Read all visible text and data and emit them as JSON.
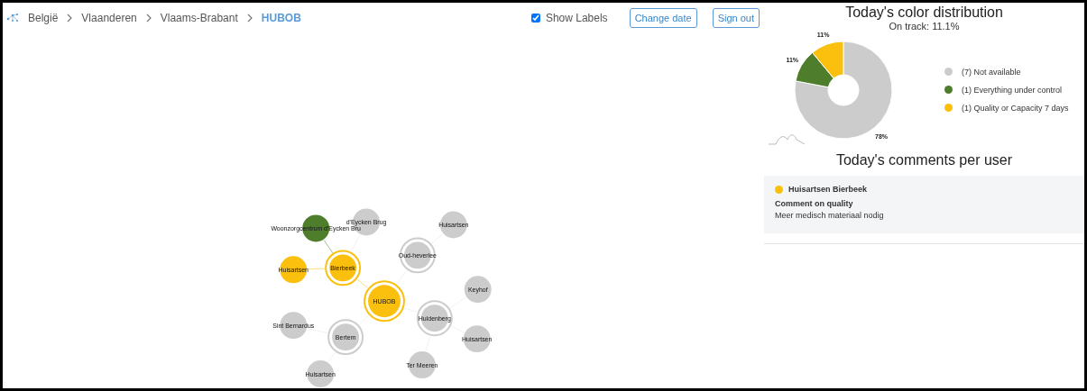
{
  "breadcrumb": {
    "items": [
      "België",
      "Vlaanderen",
      "Vlaams-Brabant"
    ],
    "current": "HUBOB"
  },
  "show_labels": {
    "label": "Show Labels",
    "checked": true
  },
  "buttons": [
    "Change date",
    "Sign out"
  ],
  "graph": {
    "root": {
      "label": "HUBOB",
      "color": "#fbbf0e",
      "children": [
        {
          "label": "Bierbeek",
          "color": "#fbbf0e",
          "children": [
            {
              "label": "Woonzorgcentrum d'Eycken Bru",
              "color": "#4e7e2c"
            },
            {
              "label": "d'Eycken Brug",
              "color": "#cccccc"
            },
            {
              "label": "Huisartsen",
              "color": "#fbbf0e"
            }
          ]
        },
        {
          "label": "Oud-heverlee",
          "color": "#cccccc",
          "children": [
            {
              "label": "Huisartsen",
              "color": "#cccccc"
            }
          ]
        },
        {
          "label": "Huldenberg",
          "color": "#cccccc",
          "children": [
            {
              "label": "Keyhof",
              "color": "#cccccc"
            },
            {
              "label": "Huisartsen",
              "color": "#cccccc"
            },
            {
              "label": "Ter Meeren",
              "color": "#cccccc"
            }
          ]
        },
        {
          "label": "Bertem",
          "color": "#cccccc",
          "children": [
            {
              "label": "Sint Bernardus",
              "color": "#cccccc"
            },
            {
              "label": "Huisartsen",
              "color": "#cccccc"
            }
          ]
        }
      ]
    }
  },
  "distribution": {
    "title": "Today's color distribution",
    "subtitle": "On track: 11.1%",
    "chart_data": {
      "type": "donut",
      "categories": [
        "(7) Not available",
        "(1) Everything under control",
        "(1) Quality or Capacity 7 days"
      ],
      "values": [
        78,
        11,
        11
      ],
      "colors": [
        "#cccccc",
        "#4e7e2c",
        "#fbbf0e"
      ],
      "value_labels": [
        "78%",
        "11%",
        "11%"
      ]
    }
  },
  "comments": {
    "title": "Today's comments per user",
    "items": [
      {
        "user": "Huisartsen Bierbeek",
        "color": "#fbbf0e",
        "heading": "Comment on quality",
        "text": "Meer medisch materiaal nodig"
      }
    ]
  }
}
